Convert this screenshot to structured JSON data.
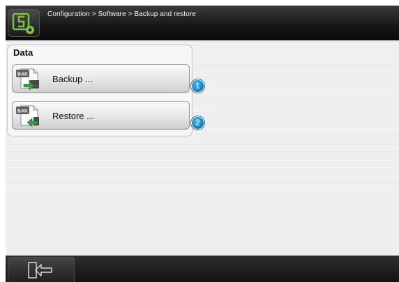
{
  "header": {
    "breadcrumb": "Configuration > Software > Backup and restore",
    "app_icon": "software-config-icon"
  },
  "data_group": {
    "title": "Data",
    "buttons": [
      {
        "label": "Backup ...",
        "icon": "backup-file-icon",
        "icon_text": "BAK",
        "badge": "1"
      },
      {
        "label": "Restore ...",
        "icon": "restore-file-icon",
        "icon_text": "BAK",
        "badge": "2"
      }
    ]
  },
  "footer": {
    "exit_icon": "exit-icon"
  },
  "colors": {
    "accent_green": "#7ac143",
    "badge_blue": "#0e79b6",
    "header_dark": "#151515"
  }
}
